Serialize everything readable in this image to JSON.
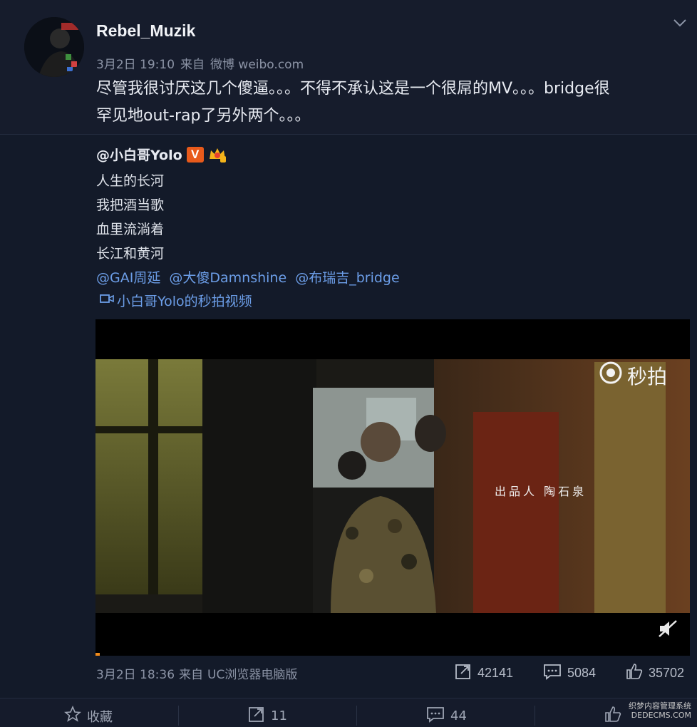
{
  "post": {
    "username": "Rebel_Muzik",
    "date": "3月2日 19:10",
    "source_prefix": "来自",
    "source": "微博 weibo.com",
    "text_line1": "尽管我很讨厌这几个傻逼。。。不得不承认这是一个很屌的MV。。。bridge很",
    "text_line2": "罕见地out-rap了另外两个。。。"
  },
  "repost": {
    "username": "@小白哥Yolo",
    "v_badge": "V",
    "lines": [
      "人生的长河",
      "我把酒当歌",
      "血里流淌着",
      "长江和黄河"
    ],
    "mentions": [
      "@GAI周延",
      "@大傻Damnshine",
      "@布瑞吉_bridge"
    ],
    "video_link": "小白哥Yolo的秒拍视频",
    "video": {
      "watermark": "秒拍",
      "credit": "出品人  陶石泉"
    },
    "date": "3月2日 18:36",
    "source_prefix": "来自",
    "source": "UC浏览器电脑版",
    "reposts": "42141",
    "comments": "5084",
    "likes": "35702"
  },
  "actions": {
    "favorite": "收藏",
    "repost": "11",
    "comment": "44"
  },
  "site_mark": {
    "line1": "织梦内容管理系统",
    "line2": "DEDECMS.COM"
  },
  "colors": {
    "background": "#151b2b",
    "link": "#6c9ee8",
    "verified": "#e85a1b",
    "progress": "#f08a1a"
  },
  "icons": [
    "chevron-down-icon",
    "v-verified-icon",
    "crown-icon",
    "video-camera-icon",
    "miaopai-logo-icon",
    "mute-icon",
    "repost-icon",
    "comment-icon",
    "like-icon",
    "star-icon"
  ]
}
